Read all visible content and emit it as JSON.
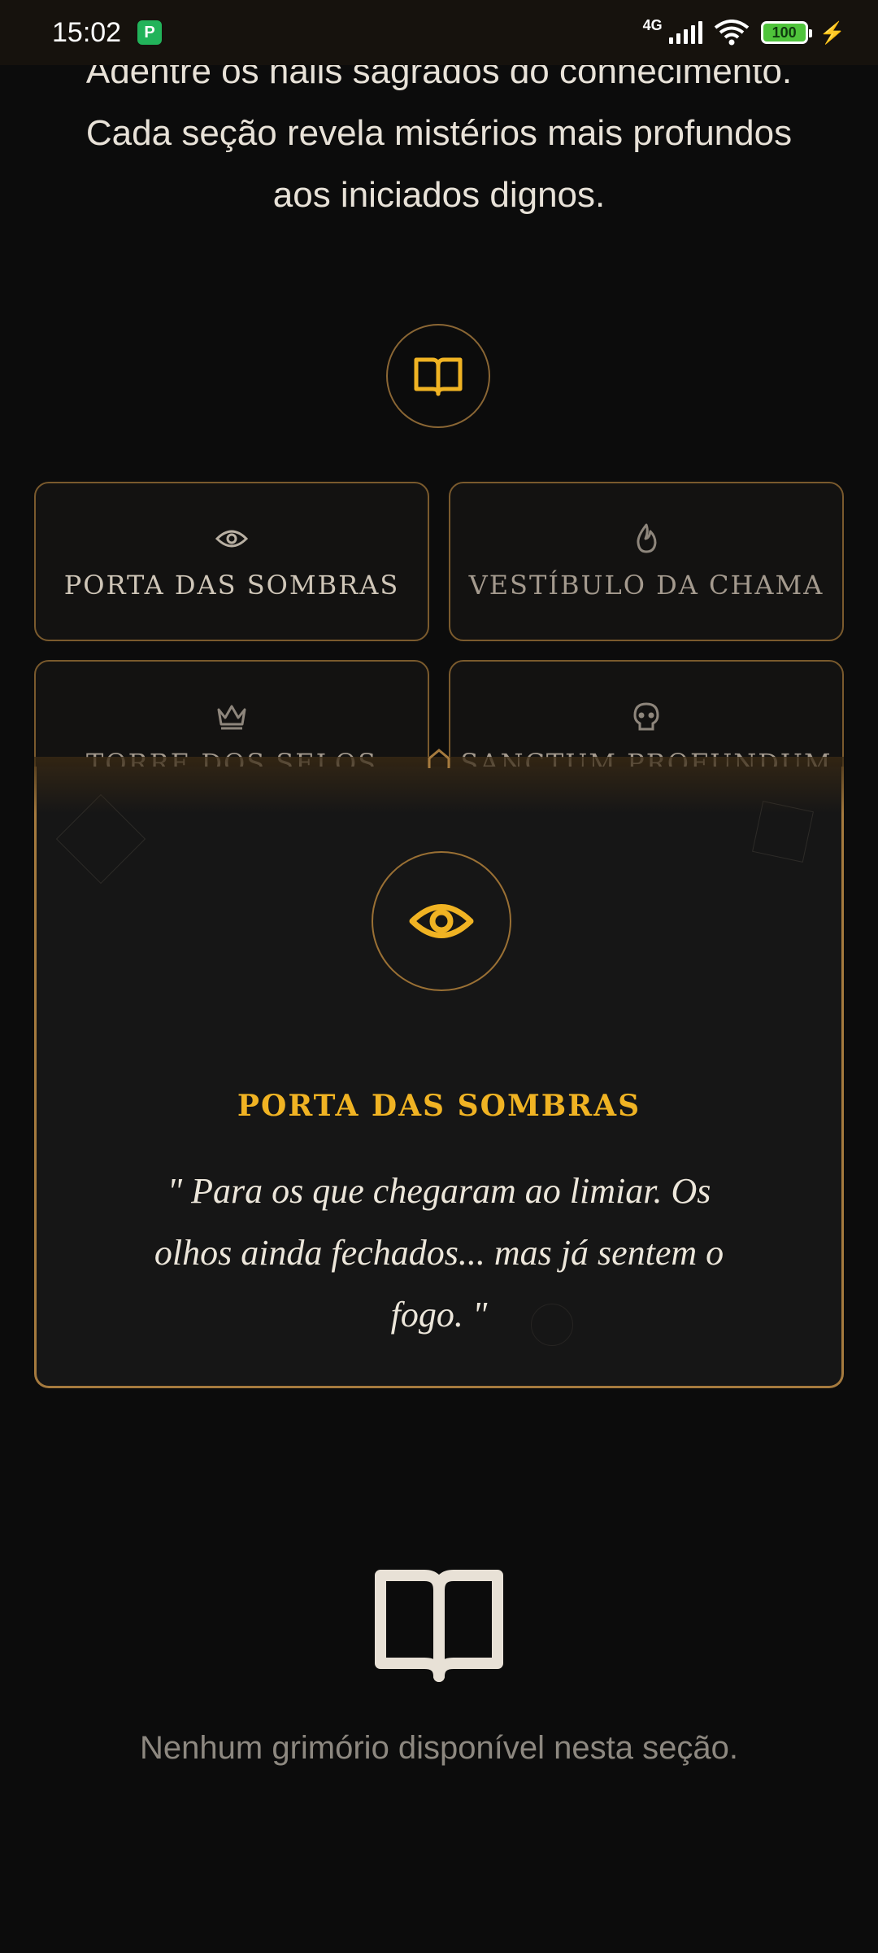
{
  "status_bar": {
    "time": "15:02",
    "app_badge": "P",
    "network": "4G",
    "battery": "100",
    "icons": [
      "signal-icon",
      "wifi-icon",
      "battery-icon",
      "charging-icon"
    ]
  },
  "intro": {
    "lines": [
      "Adentre os halls sagrados do conhecimento.",
      "Cada seção revela mistérios mais profundos",
      "aos iniciados dignos."
    ]
  },
  "header_icon": "book-icon",
  "sections": [
    {
      "label": "PORTA DAS SOMBRAS",
      "icon": "eye-icon",
      "active": true
    },
    {
      "label": "VESTÍBULO DA CHAMA",
      "icon": "flame-icon",
      "active": false
    },
    {
      "label": "TORRE DOS SELOS",
      "icon": "crown-icon",
      "active": false
    },
    {
      "label": "SANCTUM PROFUNDUM",
      "icon": "skull-icon",
      "active": false
    }
  ],
  "detail": {
    "icon": "eye-icon",
    "title": "PORTA DAS SOMBRAS",
    "quote": "\" Para os que chegaram ao limiar. Os olhos ainda fechados... mas já sentem o fogo. \""
  },
  "empty_state": {
    "icon": "open-book-icon",
    "message": "Nenhum grimório disponível nesta seção."
  },
  "colors": {
    "background": "#0c0c0c",
    "accent_gold": "#f0b323",
    "border_bronze": "#a57a3e",
    "text_muted": "#8d8880"
  }
}
